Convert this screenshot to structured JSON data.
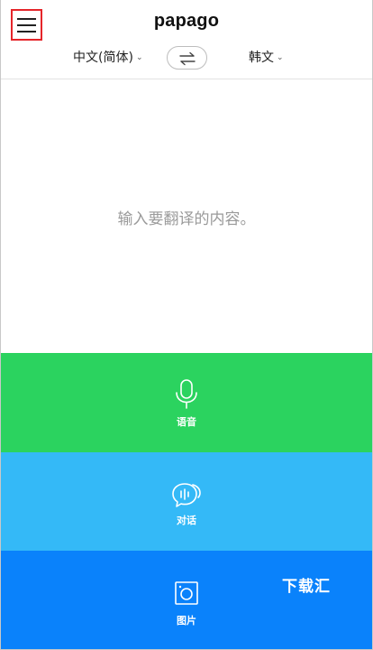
{
  "header": {
    "logo": "papago",
    "menu_icon": "hamburger-menu-icon",
    "highlight_color": "#e5252a"
  },
  "languages": {
    "source": "中文(简体)",
    "target": "韩文",
    "swap_icon": "swap-arrows-icon"
  },
  "input": {
    "placeholder": "输入要翻译的内容。"
  },
  "panels": [
    {
      "label": "语音",
      "icon": "microphone-icon",
      "color": "#2bd35f"
    },
    {
      "label": "对话",
      "icon": "chat-bubbles-icon",
      "color": "#34b9f7"
    },
    {
      "label": "图片",
      "icon": "image-camera-icon",
      "color": "#0a82fb"
    }
  ],
  "watermark": "下载汇"
}
